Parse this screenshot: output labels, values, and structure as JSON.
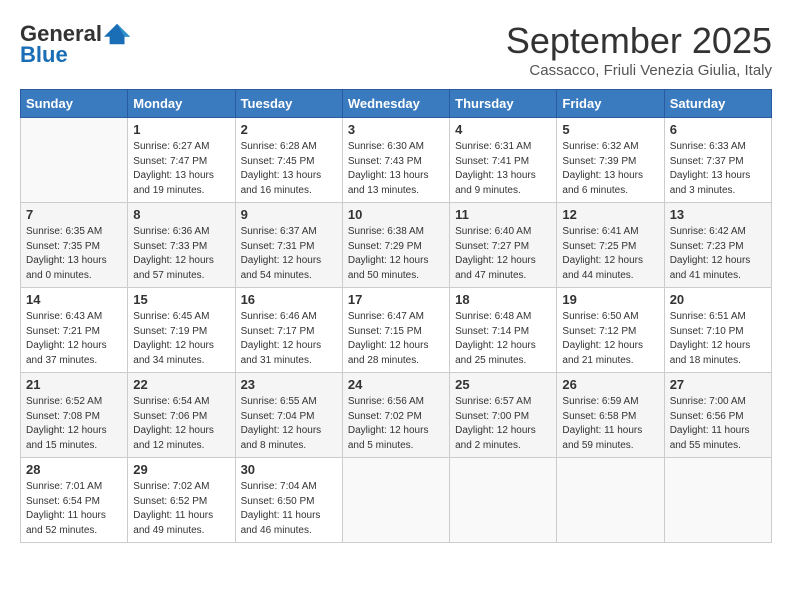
{
  "logo": {
    "general": "General",
    "blue": "Blue"
  },
  "header": {
    "month": "September 2025",
    "location": "Cassacco, Friuli Venezia Giulia, Italy"
  },
  "weekdays": [
    "Sunday",
    "Monday",
    "Tuesday",
    "Wednesday",
    "Thursday",
    "Friday",
    "Saturday"
  ],
  "weeks": [
    [
      {
        "day": "",
        "info": ""
      },
      {
        "day": "1",
        "info": "Sunrise: 6:27 AM\nSunset: 7:47 PM\nDaylight: 13 hours\nand 19 minutes."
      },
      {
        "day": "2",
        "info": "Sunrise: 6:28 AM\nSunset: 7:45 PM\nDaylight: 13 hours\nand 16 minutes."
      },
      {
        "day": "3",
        "info": "Sunrise: 6:30 AM\nSunset: 7:43 PM\nDaylight: 13 hours\nand 13 minutes."
      },
      {
        "day": "4",
        "info": "Sunrise: 6:31 AM\nSunset: 7:41 PM\nDaylight: 13 hours\nand 9 minutes."
      },
      {
        "day": "5",
        "info": "Sunrise: 6:32 AM\nSunset: 7:39 PM\nDaylight: 13 hours\nand 6 minutes."
      },
      {
        "day": "6",
        "info": "Sunrise: 6:33 AM\nSunset: 7:37 PM\nDaylight: 13 hours\nand 3 minutes."
      }
    ],
    [
      {
        "day": "7",
        "info": "Sunrise: 6:35 AM\nSunset: 7:35 PM\nDaylight: 13 hours\nand 0 minutes."
      },
      {
        "day": "8",
        "info": "Sunrise: 6:36 AM\nSunset: 7:33 PM\nDaylight: 12 hours\nand 57 minutes."
      },
      {
        "day": "9",
        "info": "Sunrise: 6:37 AM\nSunset: 7:31 PM\nDaylight: 12 hours\nand 54 minutes."
      },
      {
        "day": "10",
        "info": "Sunrise: 6:38 AM\nSunset: 7:29 PM\nDaylight: 12 hours\nand 50 minutes."
      },
      {
        "day": "11",
        "info": "Sunrise: 6:40 AM\nSunset: 7:27 PM\nDaylight: 12 hours\nand 47 minutes."
      },
      {
        "day": "12",
        "info": "Sunrise: 6:41 AM\nSunset: 7:25 PM\nDaylight: 12 hours\nand 44 minutes."
      },
      {
        "day": "13",
        "info": "Sunrise: 6:42 AM\nSunset: 7:23 PM\nDaylight: 12 hours\nand 41 minutes."
      }
    ],
    [
      {
        "day": "14",
        "info": "Sunrise: 6:43 AM\nSunset: 7:21 PM\nDaylight: 12 hours\nand 37 minutes."
      },
      {
        "day": "15",
        "info": "Sunrise: 6:45 AM\nSunset: 7:19 PM\nDaylight: 12 hours\nand 34 minutes."
      },
      {
        "day": "16",
        "info": "Sunrise: 6:46 AM\nSunset: 7:17 PM\nDaylight: 12 hours\nand 31 minutes."
      },
      {
        "day": "17",
        "info": "Sunrise: 6:47 AM\nSunset: 7:15 PM\nDaylight: 12 hours\nand 28 minutes."
      },
      {
        "day": "18",
        "info": "Sunrise: 6:48 AM\nSunset: 7:14 PM\nDaylight: 12 hours\nand 25 minutes."
      },
      {
        "day": "19",
        "info": "Sunrise: 6:50 AM\nSunset: 7:12 PM\nDaylight: 12 hours\nand 21 minutes."
      },
      {
        "day": "20",
        "info": "Sunrise: 6:51 AM\nSunset: 7:10 PM\nDaylight: 12 hours\nand 18 minutes."
      }
    ],
    [
      {
        "day": "21",
        "info": "Sunrise: 6:52 AM\nSunset: 7:08 PM\nDaylight: 12 hours\nand 15 minutes."
      },
      {
        "day": "22",
        "info": "Sunrise: 6:54 AM\nSunset: 7:06 PM\nDaylight: 12 hours\nand 12 minutes."
      },
      {
        "day": "23",
        "info": "Sunrise: 6:55 AM\nSunset: 7:04 PM\nDaylight: 12 hours\nand 8 minutes."
      },
      {
        "day": "24",
        "info": "Sunrise: 6:56 AM\nSunset: 7:02 PM\nDaylight: 12 hours\nand 5 minutes."
      },
      {
        "day": "25",
        "info": "Sunrise: 6:57 AM\nSunset: 7:00 PM\nDaylight: 12 hours\nand 2 minutes."
      },
      {
        "day": "26",
        "info": "Sunrise: 6:59 AM\nSunset: 6:58 PM\nDaylight: 11 hours\nand 59 minutes."
      },
      {
        "day": "27",
        "info": "Sunrise: 7:00 AM\nSunset: 6:56 PM\nDaylight: 11 hours\nand 55 minutes."
      }
    ],
    [
      {
        "day": "28",
        "info": "Sunrise: 7:01 AM\nSunset: 6:54 PM\nDaylight: 11 hours\nand 52 minutes."
      },
      {
        "day": "29",
        "info": "Sunrise: 7:02 AM\nSunset: 6:52 PM\nDaylight: 11 hours\nand 49 minutes."
      },
      {
        "day": "30",
        "info": "Sunrise: 7:04 AM\nSunset: 6:50 PM\nDaylight: 11 hours\nand 46 minutes."
      },
      {
        "day": "",
        "info": ""
      },
      {
        "day": "",
        "info": ""
      },
      {
        "day": "",
        "info": ""
      },
      {
        "day": "",
        "info": ""
      }
    ]
  ]
}
